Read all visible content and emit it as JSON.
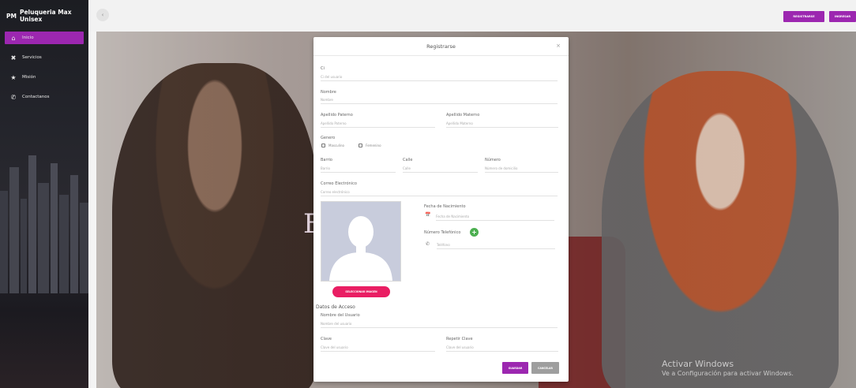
{
  "app": {
    "short_name": "PM",
    "name": "Peluqueria Max Unisex"
  },
  "sidebar": {
    "items": [
      {
        "label": "Inicio",
        "icon": "home-icon",
        "active": true
      },
      {
        "label": "Servicios",
        "icon": "scissors-icon",
        "active": false
      },
      {
        "label": "Misión",
        "icon": "star-icon",
        "active": false
      },
      {
        "label": "Contactanos",
        "icon": "phone-icon",
        "active": false
      }
    ]
  },
  "topbar": {
    "toggle_icon": "chevron-left-icon",
    "register_label": "REGISTRARSE",
    "login_label": "INGRESAR"
  },
  "hero": {
    "letter": "E"
  },
  "modal": {
    "title": "Registrarse",
    "close": "×",
    "ci": {
      "label": "Ci",
      "placeholder": "Ci del usuario"
    },
    "nombre": {
      "label": "Nombre",
      "placeholder": "Nombre"
    },
    "apellido_paterno": {
      "label": "Apellido Paterno",
      "placeholder": "Apellido Paterno"
    },
    "apellido_materno": {
      "label": "Apellido Materno",
      "placeholder": "Apellido Materno"
    },
    "genero": {
      "label": "Genero",
      "options": [
        "Masculino",
        "Femenino"
      ]
    },
    "barrio": {
      "label": "Barrio",
      "placeholder": "Barrio"
    },
    "calle": {
      "label": "Calle",
      "placeholder": "Calle"
    },
    "numero": {
      "label": "Número",
      "placeholder": "Número de domicilio"
    },
    "correo": {
      "label": "Correo Electrónico",
      "placeholder": "Correo electrónico"
    },
    "fecha": {
      "label": "Fecha de Nacimiento",
      "placeholder": "Fecha de Nacimiento"
    },
    "telefono": {
      "label": "Número Telefónico",
      "placeholder": "Teléfono",
      "add": "+"
    },
    "select_image_label": "SELECCIONAR IMAGEN",
    "datos_acceso": "Datos de Acceso",
    "usuario": {
      "label": "Nombre del Usuario",
      "placeholder": "Nombre del usuario"
    },
    "clave": {
      "label": "Clave",
      "placeholder": "Clave del usuario"
    },
    "repetir_clave": {
      "label": "Repetir Clave",
      "placeholder": "Clave del usuario"
    },
    "save_label": "GUARDAR",
    "cancel_label": "CANCELAR"
  },
  "watermark": {
    "line1": "Activar Windows",
    "line2": "Ve a Configuración para activar Windows."
  },
  "colors": {
    "accent": "#9c27b0",
    "pink": "#e91e63",
    "green": "#4caf50"
  }
}
